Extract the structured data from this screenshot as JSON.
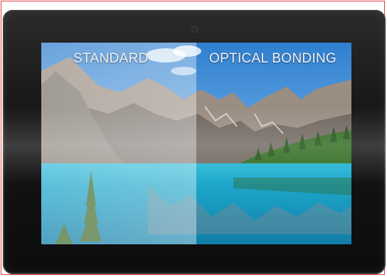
{
  "labels": {
    "standard": "STANDARD",
    "optical_bonding": "OPTICAL BONDING"
  },
  "colors": {
    "bezel": "#161616",
    "sky": "#3f8ed8",
    "lake": "#1aa7c9",
    "forest": "#2f6b1f",
    "mountain": "#8a7f76",
    "frame_border": "#e04040"
  }
}
